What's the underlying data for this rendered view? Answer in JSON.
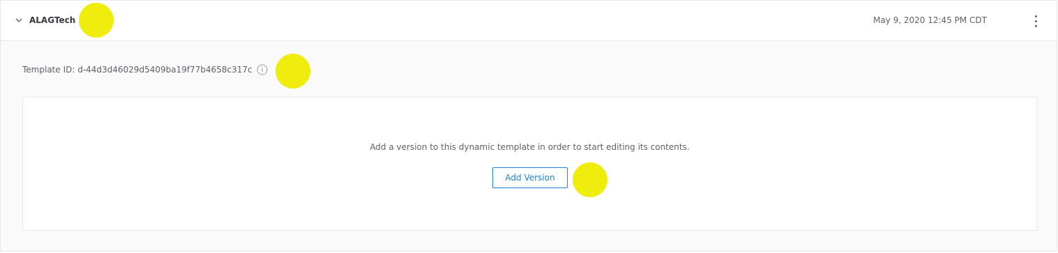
{
  "template": {
    "name": "ALAGTech",
    "date": "May 9, 2020 12:45 PM CDT",
    "template_id_label": "Template ID: d-44d3d46029d5409ba19f77b4658c317c"
  },
  "empty_state": {
    "message": "Add a version to this dynamic template in order to start editing its contents.",
    "button_label": "Add Version"
  },
  "colors": {
    "accent": "#1a82e2",
    "marker": "#f0ec0c",
    "text": "#343a40",
    "muted": "#5b6269"
  },
  "icons": {
    "collapse": "chevron-down-icon",
    "menu": "kebab-menu-icon",
    "info": "info-icon"
  }
}
